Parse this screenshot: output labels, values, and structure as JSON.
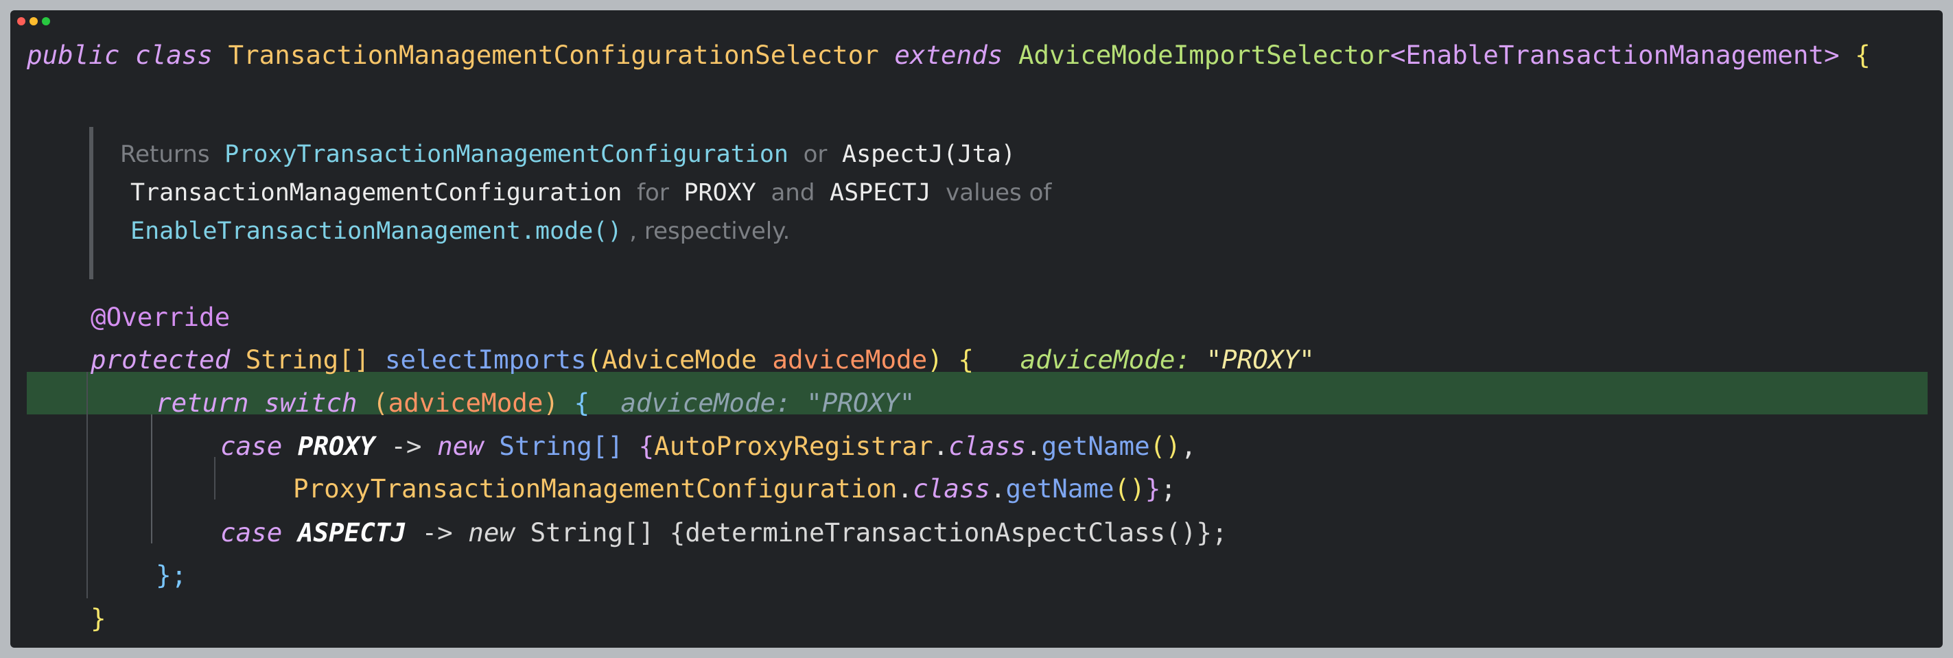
{
  "window": {
    "traffic_lights": [
      "#ff5f57",
      "#febc2e",
      "#28c840"
    ]
  },
  "line1": {
    "public": "public",
    "class": "class",
    "class_name": "TransactionManagementConfigurationSelector",
    "extends": "extends",
    "super_class": "AdviceModeImportSelector",
    "lt": "<",
    "generic": "EnableTransactionManagement",
    "gt": ">",
    "brace": "{"
  },
  "doc": {
    "returns": "Returns",
    "proxy_config": "ProxyTransactionManagementConfiguration",
    "or": "or",
    "aspectj_jta": "AspectJ(Jta)",
    "tx_config": "TransactionManagementConfiguration",
    "for": "for",
    "proxy": "PROXY",
    "and": "and",
    "aspectj": "ASPECTJ",
    "values_of": "values of",
    "mode_ref": "EnableTransactionManagement.mode()",
    "respectively": ", respectively."
  },
  "override": "@Override",
  "method_decl": {
    "protected": "protected",
    "return_type": "String[]",
    "name": "selectImports",
    "open_paren": "(",
    "param_type": "AdviceMode",
    "param_name": "adviceMode",
    "close_paren": ")",
    "brace": "{",
    "hint_label": "adviceMode:",
    "hint_value": "\"PROXY\""
  },
  "return_line": {
    "return": "return",
    "switch": "switch",
    "open_paren": "(",
    "arg": "adviceMode",
    "close_paren": ")",
    "brace": "{",
    "hint_label": "adviceMode:",
    "hint_value": "\"PROXY\""
  },
  "case_proxy": {
    "case": "case",
    "label": "PROXY",
    "arrow": "->",
    "new": "new",
    "type": "String[]",
    "open": "{",
    "registrar": "AutoProxyRegistrar",
    "dot1": ".",
    "class_kw": "class",
    "dot2": ".",
    "get_name": "getName",
    "parens": "()",
    "comma": ","
  },
  "case_proxy_cont": {
    "config": "ProxyTransactionManagementConfiguration",
    "dot1": ".",
    "class_kw": "class",
    "dot2": ".",
    "get_name": "getName",
    "parens": "()",
    "close": "}",
    "semi": ";"
  },
  "case_aspectj": {
    "case": "case",
    "label": "ASPECTJ",
    "arrow": "->",
    "new": "new",
    "rest": "String[] {determineTransactionAspectClass()};"
  },
  "switch_close": "};",
  "method_close": "}"
}
